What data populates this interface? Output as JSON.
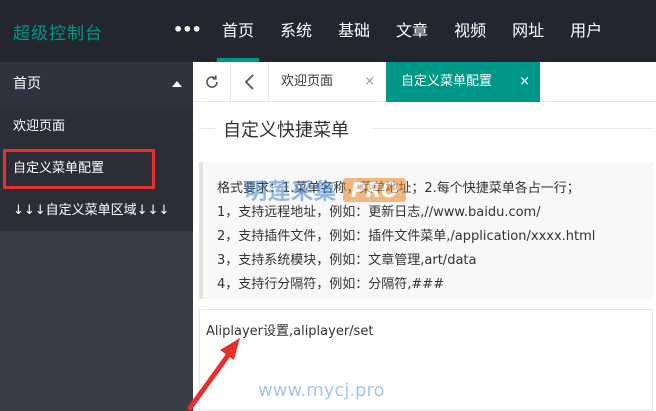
{
  "app": {
    "title": "超级控制台",
    "more": "•••"
  },
  "nav": {
    "items": [
      {
        "label": "首页",
        "active": true
      },
      {
        "label": "系统"
      },
      {
        "label": "基础"
      },
      {
        "label": "文章"
      },
      {
        "label": "视频"
      },
      {
        "label": "网址"
      },
      {
        "label": "用户"
      }
    ]
  },
  "sidebar": {
    "header": "首页",
    "items": [
      {
        "label": "欢迎页面"
      },
      {
        "label": "自定义菜单配置",
        "highlighted": true
      },
      {
        "label": "↓↓↓自定义菜单区域↓↓↓"
      }
    ]
  },
  "tabs": {
    "items": [
      {
        "label": "欢迎页面",
        "close": "×"
      },
      {
        "label": "自定义菜单配置",
        "close": "×",
        "active": true
      }
    ]
  },
  "main": {
    "legend": "自定义快捷菜单",
    "help": [
      "格式要求：1.菜单名称，菜单地址；2.每个快捷菜单各占一行；",
      "1，支持远程地址，例如：更新日志,//www.baidu.com/",
      "2，支持插件文件，例如：插件文件菜单,/application/xxxx.html",
      "3，支持系统模块，例如：文章管理,art/data",
      "4，支持行分隔符，例如：分隔符,###"
    ],
    "textarea_value": "Aliplayer设置,aliplayer/set"
  },
  "watermark": {
    "text": "明莲采集",
    "badge": "PRO",
    "url": "www.mycj.pro"
  },
  "colors": {
    "accent": "#009688",
    "topbar": "#23262e",
    "sidebar": "#393d49",
    "highlight_box": "#e5302e"
  }
}
